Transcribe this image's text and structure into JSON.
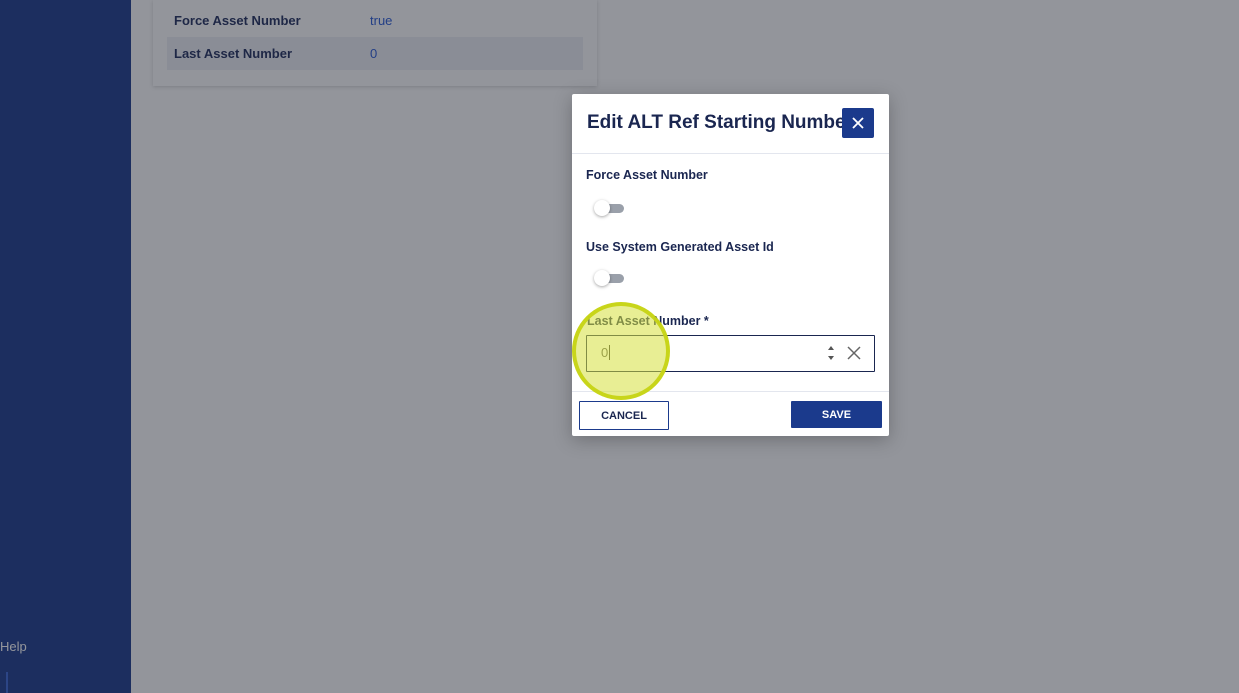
{
  "sidebar": {
    "help_label": "Help"
  },
  "background_panel": {
    "rows": [
      {
        "label": "Force Asset Number",
        "value": "true"
      },
      {
        "label": "Last Asset Number",
        "value": "0"
      }
    ]
  },
  "dialog": {
    "title": "Edit ALT Ref Starting Number",
    "close_icon": "close-icon",
    "fields": {
      "force_asset_number": {
        "label": "Force Asset Number",
        "enabled": false
      },
      "use_system_generated": {
        "label": "Use System Generated Asset Id",
        "enabled": false
      },
      "last_asset_number": {
        "label": "Last Asset Number *",
        "value": "0"
      }
    },
    "cancel_label": "CANCEL",
    "save_label": "SAVE"
  },
  "colors": {
    "primary": "#1b3a8c",
    "highlight": "#d6e03c",
    "link_value": "#2a5bd7"
  }
}
